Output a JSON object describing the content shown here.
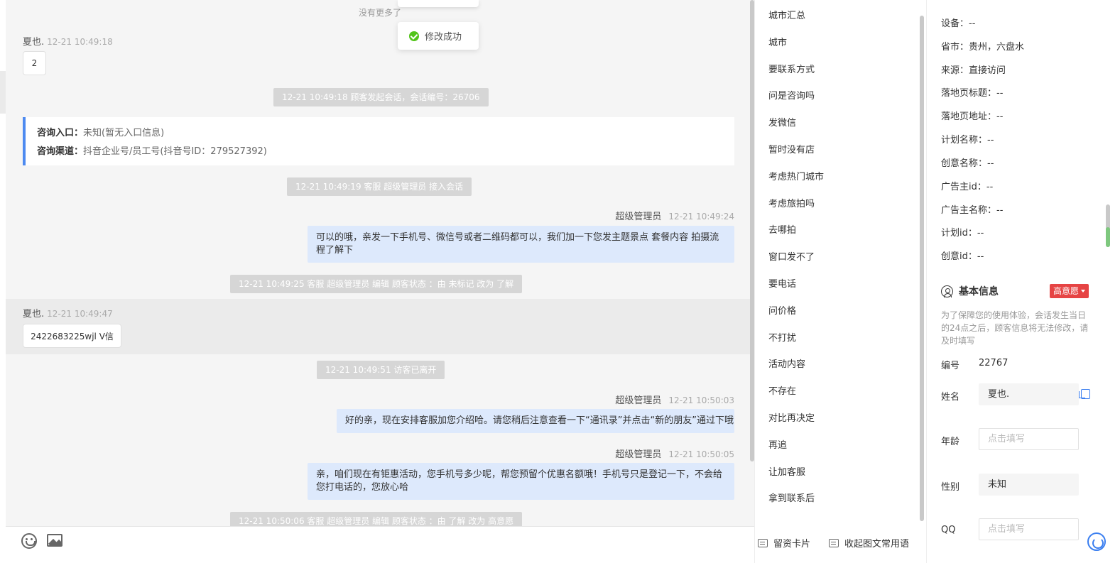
{
  "chat": {
    "no_more": "没有更多了",
    "toast": "修改成功",
    "messages": {
      "m1_sender": "夏也.",
      "m1_time": "12-21 10:49:18",
      "m1_text": "2",
      "sys1": "12-21 10:49:18 顾客发起会话，会话编号：26706",
      "card_entry_label": "咨询入口：",
      "card_entry_value": "未知(暂无入口信息)",
      "card_channel_label": "咨询渠道：",
      "card_channel_value": "抖音企业号/员工号(抖音号ID：279527392)",
      "sys2": "12-21 10:49:19 客服 超级管理员 接入会话",
      "a1_name": "超级管理员",
      "a1_time": "12-21 10:49:24",
      "a1_text": "可以的哦，亲发一下手机号、微信号或者二维码都可以，我们加一下您发主题景点 套餐内容 拍摄流程了解下",
      "sys3": "12-21 10:49:25 客服 超级管理员 编辑 顾客状态 ：由 未标记 改为 了解",
      "m2_sender": "夏也.",
      "m2_time": "12-21 10:49:47",
      "m2_text": "2422683225wjl  V信",
      "sys4": "12-21 10:49:51 访客已离开",
      "a2_name": "超级管理员",
      "a2_time": "12-21 10:50:03",
      "a2_text": "好的亲，现在安排客服加您介绍哈。请您稍后注意查看一下“通讯录”并点击“新的朋友”通过下哦",
      "a3_name": "超级管理员",
      "a3_time": "12-21 10:50:05",
      "a3_text": "亲，咱们现在有钜惠活动，您手机号多少呢，帮您预留个优惠名额哦！手机号只是登记一下，不会给您打电话的，您放心哈",
      "sys5": "12-21 10:50:06 客服 超级管理员 编辑 顾客状态 ：由 了解 改为 高意愿"
    }
  },
  "phrases": {
    "items": [
      "城市汇总",
      "城市",
      "要联系方式",
      "问是咨询吗",
      "发微信",
      "暂时没有店",
      "考虑热门城市",
      "考虑旅拍吗",
      "去哪拍",
      "窗口发不了",
      "要电话",
      "问价格",
      "不打扰",
      "活动内容",
      "不存在",
      "对比再决定",
      "再追",
      "让加客服",
      "拿到联系后"
    ],
    "footer_card": "留资卡片",
    "footer_collapse": "收起图文常用语"
  },
  "customer": {
    "kv": [
      {
        "label": "设备：",
        "value": "--"
      },
      {
        "label": "省市：",
        "value": "贵州，六盘水"
      },
      {
        "label": "来源：",
        "value": "直接访问"
      },
      {
        "label": "落地页标题：",
        "value": "--"
      },
      {
        "label": "落地页地址：",
        "value": "--"
      },
      {
        "label": "计划名称：",
        "value": "--"
      },
      {
        "label": "创意名称：",
        "value": "--"
      },
      {
        "label": "广告主id：",
        "value": "--"
      },
      {
        "label": "广告主名称：",
        "value": "--"
      },
      {
        "label": "计划id：",
        "value": "--"
      },
      {
        "label": "创意id：",
        "value": "--"
      }
    ],
    "section_title": "基本信息",
    "intent": "高意愿",
    "notice": "为了保障您的使用体验，会话发生当日的24点之后，顾客信息将无法修改，请及时填写",
    "id_label": "编号",
    "id_value": "22767",
    "name_label": "姓名",
    "name_value": "夏也.",
    "age_label": "年龄",
    "age_placeholder": "点击填写",
    "gender_label": "性别",
    "gender_value": "未知",
    "qq_label": "QQ",
    "qq_placeholder": "点击填写"
  }
}
